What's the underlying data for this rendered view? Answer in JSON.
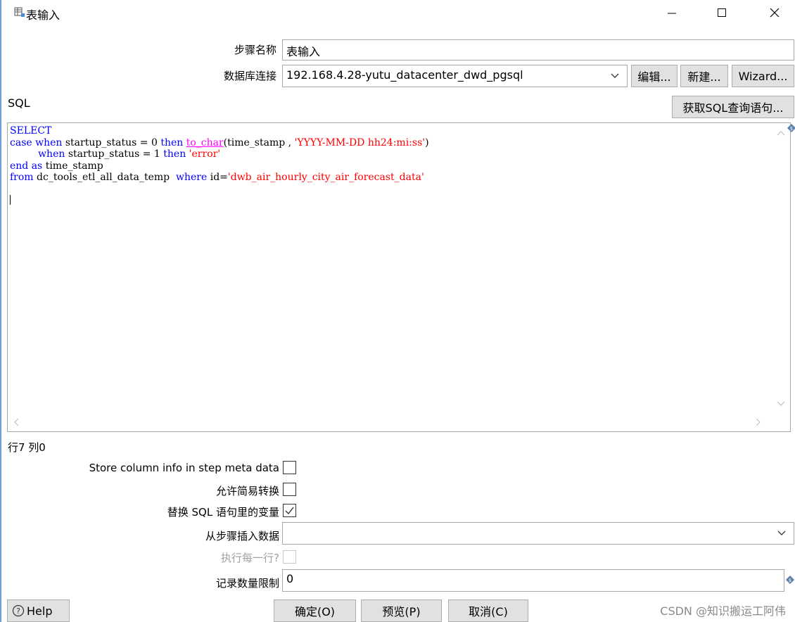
{
  "window": {
    "title": "表输入"
  },
  "form": {
    "step_name_label": "步骤名称",
    "step_name_value": "表输入",
    "connection_label": "数据库连接",
    "connection_value": "192.168.4.28-yutu_datacenter_dwd_pgsql",
    "edit_button": "编辑...",
    "new_button": "新建...",
    "wizard_button": "Wizard...",
    "sql_label": "SQL",
    "get_sql_button": "获取SQL查询语句...",
    "position_status": "行7 列0",
    "store_column_info_label": "Store column info in step meta data",
    "store_column_info_checked": false,
    "lazy_conversion_label": "允许简易转换",
    "lazy_conversion_checked": false,
    "replace_vars_label": "替换 SQL 语句里的变量",
    "replace_vars_checked": true,
    "insert_from_step_label": "从步骤插入数据",
    "insert_from_step_value": "",
    "execute_each_row_label": "执行每一行?",
    "execute_each_row_checked": false,
    "limit_label": "记录数量限制",
    "limit_value": "0"
  },
  "sql": {
    "line1": "SELECT",
    "line2_kw1": "case when",
    "line2_txt1": " startup_status = 0 ",
    "line2_kw2": "then",
    "line2_fn": "to_char",
    "line2_txt2": "(time_stamp , ",
    "line2_str": "'YYYY-MM-DD hh24:mi:ss'",
    "line2_txt3": ")",
    "line3_indent": "         ",
    "line3_kw1": "when",
    "line3_txt1": " startup_status = 1 ",
    "line3_kw2": "then",
    "line3_str": "'error'",
    "line4_kw1": "end as",
    "line4_txt1": " time_stamp",
    "line5_kw1": "from",
    "line5_txt1": " dc_tools_etl_all_data_temp  ",
    "line5_kw2": "where",
    "line5_txt2": " id=",
    "line5_str": "'dwb_air_hourly_city_air_forecast_data'"
  },
  "footer": {
    "help_button": "Help",
    "ok_button": "确定(O)",
    "preview_button": "预览(P)",
    "cancel_button": "取消(C)",
    "watermark": "CSDN @知识搬运工阿伟"
  },
  "colors": {
    "keyword": "#0000ff",
    "function": "#ff00ff",
    "string": "#ff0000",
    "window_edge": "#6f9fd8"
  }
}
